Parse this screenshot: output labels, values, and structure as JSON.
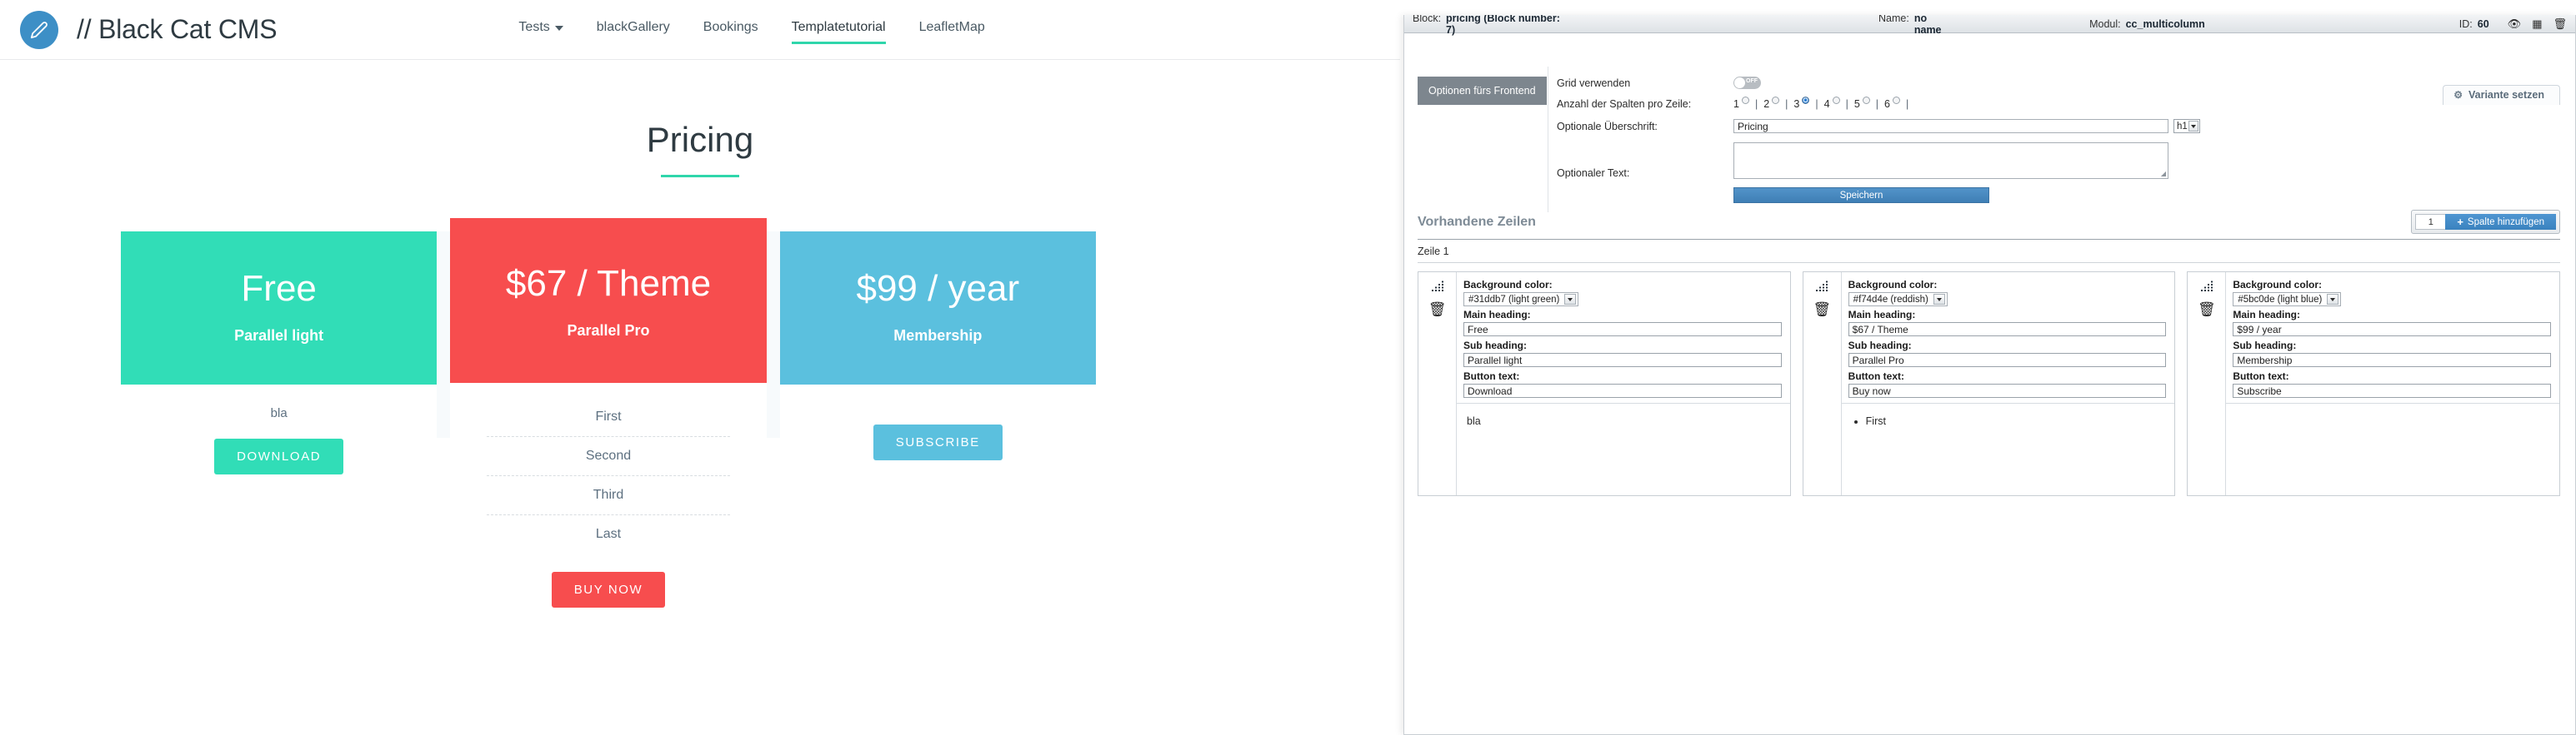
{
  "frontend": {
    "brand": {
      "title": "// Black Cat CMS",
      "logo_icon": "pencil-icon"
    },
    "nav": [
      {
        "label": "Tests",
        "has_dropdown": true,
        "active": false
      },
      {
        "label": "blackGallery",
        "has_dropdown": false,
        "active": false
      },
      {
        "label": "Bookings",
        "has_dropdown": false,
        "active": false
      },
      {
        "label": "Templatetutorial",
        "has_dropdown": false,
        "active": true
      },
      {
        "label": "LeafletMap",
        "has_dropdown": false,
        "active": false
      }
    ],
    "section": {
      "title": "Pricing"
    },
    "cards": [
      {
        "price": "Free",
        "sub": "Parallel light",
        "bg": "#31ddb7",
        "plain_text": "bla",
        "features": [],
        "button": "DOWNLOAD"
      },
      {
        "price": "$67 / Theme",
        "sub": "Parallel Pro",
        "bg": "#f74d4e",
        "plain_text": "",
        "features": [
          "First",
          "Second",
          "Third",
          "Last"
        ],
        "button": "BUY NOW"
      },
      {
        "price": "$99 / year",
        "sub": "Membership",
        "bg": "#5bc0de",
        "plain_text": "",
        "features": [],
        "button": "SUBSCRIBE"
      }
    ]
  },
  "admin": {
    "block_bar": {
      "block_label": "Block:",
      "block_value": "pricing (Block number: 7)",
      "name_label": "Name:",
      "name_value": "no name",
      "modul_label": "Modul:",
      "modul_value": "cc_multicolumn",
      "id_label": "ID:",
      "id_value": "60",
      "icons": [
        "eye-icon",
        "calendar-icon",
        "trash-icon"
      ]
    },
    "variante_tab": {
      "label": "Variante setzen",
      "icon": "gear-icon"
    },
    "options_tab": "Optionen fürs Frontend",
    "form": {
      "grid_label": "Grid verwenden",
      "grid_toggle_state": "OFF",
      "columns_label": "Anzahl der Spalten pro Zeile:",
      "columns_options": [
        "1",
        "2",
        "3",
        "4",
        "5",
        "6"
      ],
      "columns_selected": "3",
      "headline_label": "Optionale Überschrift:",
      "headline_value": "Pricing",
      "headline_tag": "h1",
      "text_label": "Optionaler Text:",
      "text_value": "",
      "save_button": "Speichern"
    },
    "rows": {
      "title": "Vorhandene Zeilen",
      "add_count": "1",
      "add_button": "Spalte hinzufügen",
      "row_label": "Zeile 1"
    },
    "columns": [
      {
        "bg_label": "Background color:",
        "bg_value": "#31ddb7 (light green)",
        "main_label": "Main heading:",
        "main_value": "Free",
        "sub_label": "Sub heading:",
        "sub_value": "Parallel light",
        "btn_label": "Button text:",
        "btn_value": "Download",
        "preview_text": "bla",
        "preview_list": []
      },
      {
        "bg_label": "Background color:",
        "bg_value": "#f74d4e (reddish)",
        "main_label": "Main heading:",
        "main_value": "$67 / Theme",
        "sub_label": "Sub heading:",
        "sub_value": "Parallel Pro",
        "btn_label": "Button text:",
        "btn_value": "Buy now",
        "preview_text": "",
        "preview_list": [
          "First"
        ]
      },
      {
        "bg_label": "Background color:",
        "bg_value": "#5bc0de (light blue)",
        "main_label": "Main heading:",
        "main_value": "$99 / year",
        "sub_label": "Sub heading:",
        "sub_value": "Membership",
        "btn_label": "Button text:",
        "btn_value": "Subscribe",
        "preview_text": "",
        "preview_list": []
      }
    ]
  }
}
